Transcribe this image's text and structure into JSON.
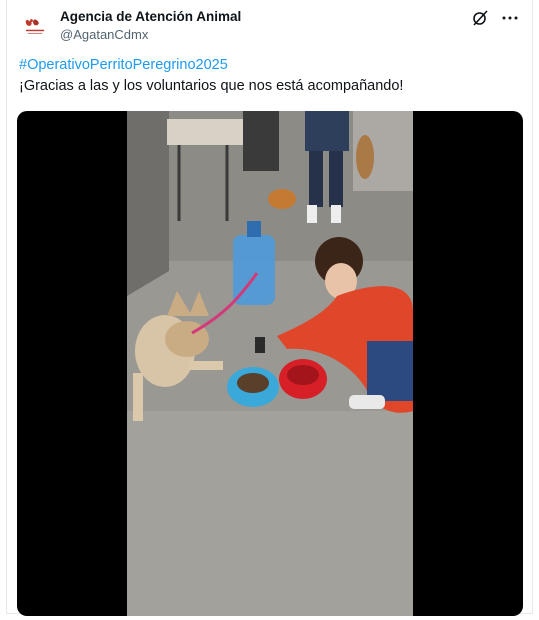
{
  "post": {
    "author_name": "Agencia de Atención Animal",
    "author_handle": "@AgatanCdmx",
    "hashtag": "#OperativoPerritoPeregrino2025",
    "text": "¡Gracias a las y los voluntarios que nos está acompañando!"
  },
  "icons": {
    "grok": "grok-icon",
    "more": "more-icon"
  },
  "media": {
    "type": "video",
    "description_icon": "video-frame"
  },
  "colors": {
    "link": "#1d9bf0",
    "secondary_text": "#536471",
    "primary_text": "#0f1419"
  }
}
